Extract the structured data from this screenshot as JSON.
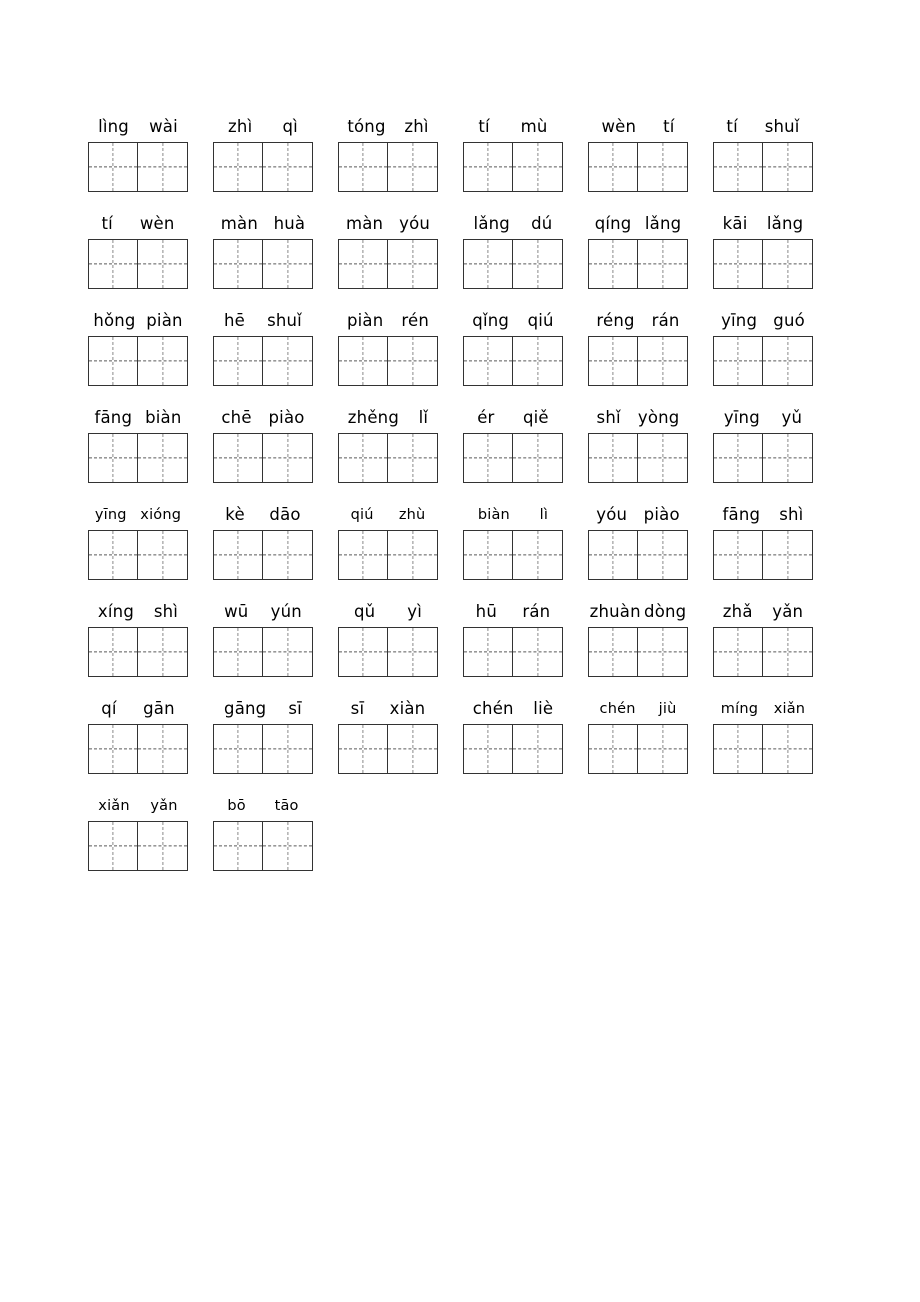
{
  "document": {
    "type": "pinyin-writing-practice-worksheet",
    "script": "hanzi-tianzige-grid",
    "columns_per_row": 6,
    "cells_per_box": 2
  },
  "rows": [
    {
      "index": 1,
      "items": [
        {
          "syllables": [
            "lìng",
            "wài"
          ],
          "size": "normal"
        },
        {
          "syllables": [
            "zhì",
            "qì"
          ],
          "size": "normal"
        },
        {
          "syllables": [
            "tóng",
            "zhì"
          ],
          "size": "normal"
        },
        {
          "syllables": [
            "tí",
            "mù"
          ],
          "size": "normal"
        },
        {
          "syllables": [
            "wèn",
            "tí"
          ],
          "size": "normal"
        },
        {
          "syllables": [
            "tí",
            "shuǐ"
          ],
          "size": "normal"
        }
      ]
    },
    {
      "index": 2,
      "items": [
        {
          "syllables": [
            "tí",
            "wèn"
          ],
          "size": "normal"
        },
        {
          "syllables": [
            "màn",
            "huà"
          ],
          "size": "normal"
        },
        {
          "syllables": [
            "màn",
            "yóu"
          ],
          "size": "normal"
        },
        {
          "syllables": [
            "lǎng",
            "dú"
          ],
          "size": "normal"
        },
        {
          "syllables": [
            "qíng",
            "lǎng"
          ],
          "size": "normal"
        },
        {
          "syllables": [
            "kāi",
            "lǎng"
          ],
          "size": "normal"
        }
      ]
    },
    {
      "index": 3,
      "items": [
        {
          "syllables": [
            "hǒng",
            "piàn"
          ],
          "size": "normal"
        },
        {
          "syllables": [
            "hē",
            "shuǐ"
          ],
          "size": "normal"
        },
        {
          "syllables": [
            "piàn",
            "rén"
          ],
          "size": "normal"
        },
        {
          "syllables": [
            "qǐng",
            "qiú"
          ],
          "size": "normal"
        },
        {
          "syllables": [
            "réng",
            "rán"
          ],
          "size": "normal"
        },
        {
          "syllables": [
            "yīng",
            "guó"
          ],
          "size": "normal"
        }
      ]
    },
    {
      "index": 4,
      "items": [
        {
          "syllables": [
            "fāng",
            "biàn"
          ],
          "size": "normal"
        },
        {
          "syllables": [
            "chē",
            "piào"
          ],
          "size": "normal"
        },
        {
          "syllables": [
            "zhěng",
            "lǐ"
          ],
          "size": "normal"
        },
        {
          "syllables": [
            "ér",
            "qiě"
          ],
          "size": "normal"
        },
        {
          "syllables": [
            "shǐ",
            "yòng"
          ],
          "size": "normal"
        },
        {
          "syllables": [
            "yīng",
            "yǔ"
          ],
          "size": "normal"
        }
      ]
    },
    {
      "index": 5,
      "items": [
        {
          "syllables": [
            "yīng",
            "xióng"
          ],
          "size": "small"
        },
        {
          "syllables": [
            "kè",
            "dāo"
          ],
          "size": "normal"
        },
        {
          "syllables": [
            "qiú",
            "zhù"
          ],
          "size": "small"
        },
        {
          "syllables": [
            "biàn",
            "lì"
          ],
          "size": "small"
        },
        {
          "syllables": [
            "yóu",
            "piào"
          ],
          "size": "normal"
        },
        {
          "syllables": [
            "fāng",
            "shì"
          ],
          "size": "normal"
        }
      ]
    },
    {
      "index": 6,
      "items": [
        {
          "syllables": [
            "xíng",
            "shì"
          ],
          "size": "normal"
        },
        {
          "syllables": [
            "wū",
            "yún"
          ],
          "size": "normal"
        },
        {
          "syllables": [
            "qǔ",
            "yì"
          ],
          "size": "normal"
        },
        {
          "syllables": [
            "hū",
            "rán"
          ],
          "size": "normal"
        },
        {
          "syllables": [
            "zhuàn",
            "dòng"
          ],
          "size": "normal"
        },
        {
          "syllables": [
            "zhǎ",
            "yǎn"
          ],
          "size": "normal"
        }
      ]
    },
    {
      "index": 7,
      "items": [
        {
          "syllables": [
            "qí",
            "gān"
          ],
          "size": "normal"
        },
        {
          "syllables": [
            "gāng",
            "sī"
          ],
          "size": "normal"
        },
        {
          "syllables": [
            "sī",
            "xiàn"
          ],
          "size": "normal"
        },
        {
          "syllables": [
            "chén",
            "liè"
          ],
          "size": "normal"
        },
        {
          "syllables": [
            "chén",
            "jiù"
          ],
          "size": "small"
        },
        {
          "syllables": [
            "míng",
            "xiǎn"
          ],
          "size": "small"
        }
      ]
    },
    {
      "index": 8,
      "items": [
        {
          "syllables": [
            "xiǎn",
            "yǎn"
          ],
          "size": "small"
        },
        {
          "syllables": [
            "bō",
            "tāo"
          ],
          "size": "small"
        }
      ]
    }
  ],
  "colors": {
    "page_background": "#ffffff",
    "text": "#000000",
    "box_border": "#333333",
    "guide_vertical_dashed": "#8a8a8a",
    "guide_horizontal_dashed": "#5a5a5a"
  }
}
